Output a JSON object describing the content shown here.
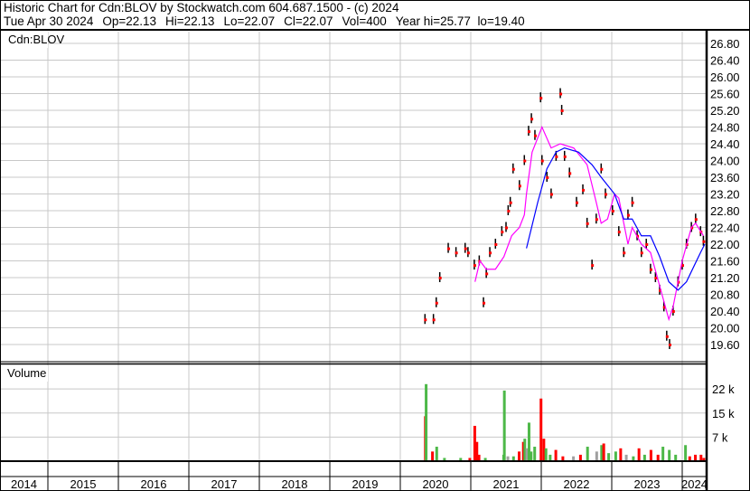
{
  "header": {
    "title": "Historic Chart for Cdn:BLOV by Stockwatch.com 604.687.1500 - (c) 2024",
    "date": "Tue Apr 30 2024",
    "open": "Op=22.13",
    "high": "Hi=22.13",
    "low": "Lo=22.07",
    "close": "Cl=22.07",
    "volume": "Vol=400",
    "year_range": "Year hi=25.77  lo=19.40"
  },
  "chart_data": [
    {
      "type": "line",
      "title": "Cdn:BLOV",
      "xlabel": "",
      "ylabel": "",
      "xlim": [
        2014,
        2024.35
      ],
      "ylim": [
        19.4,
        27.0
      ],
      "grid": true,
      "x_ticks": [
        "2014",
        "2015",
        "2016",
        "2017",
        "2018",
        "2019",
        "2020",
        "2021",
        "2022",
        "2023",
        "2024"
      ],
      "y_ticks": [
        "26.80",
        "26.40",
        "26.00",
        "25.60",
        "25.20",
        "24.80",
        "24.40",
        "24.00",
        "23.60",
        "23.20",
        "22.80",
        "22.40",
        "22.00",
        "21.60",
        "21.20",
        "20.80",
        "20.40",
        "20.00",
        "19.60"
      ],
      "colors": {
        "price": "#ff0000",
        "bar": "#000000",
        "ma_short": "#ff00ff",
        "ma_long": "#0000ff"
      },
      "series": [
        {
          "name": "price",
          "x": [
            2020.35,
            2020.47,
            2020.51,
            2020.56,
            2020.68,
            2020.79,
            2020.92,
            2020.96,
            2021.05,
            2021.12,
            2021.18,
            2021.22,
            2021.27,
            2021.35,
            2021.44,
            2021.5,
            2021.53,
            2021.56,
            2021.6,
            2021.69,
            2021.76,
            2021.82,
            2021.86,
            2021.91,
            2021.99,
            2022.01,
            2022.08,
            2022.14,
            2022.21,
            2022.27,
            2022.29,
            2022.33,
            2022.4,
            2022.5,
            2022.59,
            2022.65,
            2022.72,
            2022.78,
            2022.85,
            2022.91,
            2023.01,
            2023.1,
            2023.17,
            2023.23,
            2023.29,
            2023.36,
            2023.42,
            2023.49,
            2023.55,
            2023.62,
            2023.68,
            2023.74,
            2023.78,
            2023.82,
            2023.87,
            2023.94,
            2024.0,
            2024.06,
            2024.13,
            2024.19,
            2024.26,
            2024.3
          ],
          "y": [
            20.2,
            20.2,
            20.6,
            21.2,
            21.9,
            21.8,
            21.9,
            21.8,
            21.5,
            21.6,
            20.6,
            21.3,
            21.8,
            22.0,
            22.3,
            22.4,
            22.8,
            23.0,
            23.8,
            23.4,
            24.0,
            24.7,
            25.0,
            24.6,
            25.5,
            24.0,
            23.6,
            23.2,
            24.1,
            25.6,
            25.2,
            24.1,
            23.7,
            23.0,
            23.3,
            22.5,
            21.5,
            22.6,
            23.8,
            23.2,
            22.8,
            22.3,
            21.8,
            22.7,
            23.0,
            22.2,
            21.8,
            22.0,
            21.4,
            21.2,
            20.9,
            20.5,
            19.8,
            19.6,
            20.4,
            21.1,
            21.5,
            22.0,
            22.4,
            22.6,
            22.3,
            22.07
          ]
        },
        {
          "name": "ma_short",
          "x": [
            2021.06,
            2021.13,
            2021.22,
            2021.35,
            2021.47,
            2021.58,
            2021.69,
            2021.76,
            2021.79,
            2021.87,
            2022.01,
            2022.14,
            2022.27,
            2022.46,
            2022.65,
            2022.78,
            2022.85,
            2022.94,
            2023.04,
            2023.1,
            2023.23,
            2023.29,
            2023.42,
            2023.55,
            2023.68,
            2023.81,
            2023.87,
            2024.0,
            2024.13,
            2024.19,
            2024.3
          ],
          "y": [
            21.1,
            21.6,
            21.4,
            21.4,
            21.7,
            22.2,
            22.4,
            22.7,
            23.2,
            24.2,
            24.8,
            24.3,
            24.4,
            24.3,
            23.9,
            23.0,
            22.5,
            22.6,
            23.2,
            23.1,
            22.0,
            22.4,
            22.0,
            21.8,
            21.0,
            20.2,
            20.5,
            21.6,
            22.4,
            22.5,
            22.2
          ]
        },
        {
          "name": "ma_long",
          "x": [
            2021.79,
            2021.95,
            2022.08,
            2022.21,
            2022.33,
            2022.53,
            2022.72,
            2022.85,
            2023.04,
            2023.17,
            2023.29,
            2023.42,
            2023.55,
            2023.68,
            2023.81,
            2023.94,
            2024.06,
            2024.26,
            2024.32
          ],
          "y": [
            21.9,
            23.0,
            23.8,
            24.2,
            24.3,
            24.2,
            23.9,
            23.6,
            23.2,
            22.6,
            22.6,
            22.2,
            22.2,
            21.7,
            21.1,
            20.9,
            21.1,
            21.8,
            22.0
          ]
        }
      ]
    },
    {
      "type": "bar",
      "title": "Volume",
      "ylim": [
        0,
        28
      ],
      "y_ticks": [
        {
          "label": "22 k",
          "value": 22.5
        },
        {
          "label": "15 k",
          "value": 15
        },
        {
          "label": "7 k",
          "value": 7.5
        }
      ],
      "colors": {
        "up": "#4db848",
        "down": "#ff0000",
        "flat": "#a0a0a0"
      },
      "bars": [
        {
          "x": 2020.35,
          "v": 14,
          "c": "down"
        },
        {
          "x": 2020.36,
          "v": 24,
          "c": "up"
        },
        {
          "x": 2020.45,
          "v": 3,
          "c": "down"
        },
        {
          "x": 2020.51,
          "v": 4.5,
          "c": "up"
        },
        {
          "x": 2020.62,
          "v": 1,
          "c": "up"
        },
        {
          "x": 2020.85,
          "v": 1,
          "c": "up"
        },
        {
          "x": 2020.98,
          "v": 1,
          "c": "down"
        },
        {
          "x": 2021.05,
          "v": 11,
          "c": "down"
        },
        {
          "x": 2021.08,
          "v": 6,
          "c": "down"
        },
        {
          "x": 2021.11,
          "v": 2,
          "c": "down"
        },
        {
          "x": 2021.2,
          "v": 1,
          "c": "up"
        },
        {
          "x": 2021.46,
          "v": 2,
          "c": "up"
        },
        {
          "x": 2021.47,
          "v": 22,
          "c": "up"
        },
        {
          "x": 2021.52,
          "v": 1.5,
          "c": "flat"
        },
        {
          "x": 2021.6,
          "v": 1.5,
          "c": "up"
        },
        {
          "x": 2021.68,
          "v": 3,
          "c": "down"
        },
        {
          "x": 2021.74,
          "v": 6,
          "c": "down"
        },
        {
          "x": 2021.76,
          "v": 7,
          "c": "up"
        },
        {
          "x": 2021.79,
          "v": 4,
          "c": "flat"
        },
        {
          "x": 2021.82,
          "v": 12,
          "c": "up"
        },
        {
          "x": 2021.85,
          "v": 3,
          "c": "up"
        },
        {
          "x": 2021.9,
          "v": 4.5,
          "c": "up"
        },
        {
          "x": 2021.99,
          "v": 19.5,
          "c": "down"
        },
        {
          "x": 2022.03,
          "v": 7,
          "c": "down"
        },
        {
          "x": 2022.06,
          "v": 4,
          "c": "up"
        },
        {
          "x": 2022.12,
          "v": 2,
          "c": "up"
        },
        {
          "x": 2022.2,
          "v": 3.5,
          "c": "down"
        },
        {
          "x": 2022.3,
          "v": 1.5,
          "c": "down"
        },
        {
          "x": 2022.45,
          "v": 1.5,
          "c": "flat"
        },
        {
          "x": 2022.55,
          "v": 2,
          "c": "down"
        },
        {
          "x": 2022.65,
          "v": 4.5,
          "c": "up"
        },
        {
          "x": 2022.78,
          "v": 3,
          "c": "flat"
        },
        {
          "x": 2022.85,
          "v": 5,
          "c": "up"
        },
        {
          "x": 2022.88,
          "v": 5.5,
          "c": "down"
        },
        {
          "x": 2022.95,
          "v": 2.5,
          "c": "up"
        },
        {
          "x": 2023.05,
          "v": 3,
          "c": "up"
        },
        {
          "x": 2023.12,
          "v": 4,
          "c": "down"
        },
        {
          "x": 2023.2,
          "v": 2,
          "c": "flat"
        },
        {
          "x": 2023.3,
          "v": 1.5,
          "c": "up"
        },
        {
          "x": 2023.38,
          "v": 4,
          "c": "down"
        },
        {
          "x": 2023.46,
          "v": 2,
          "c": "up"
        },
        {
          "x": 2023.55,
          "v": 3.5,
          "c": "down"
        },
        {
          "x": 2023.65,
          "v": 2,
          "c": "down"
        },
        {
          "x": 2023.72,
          "v": 4.5,
          "c": "up"
        },
        {
          "x": 2023.81,
          "v": 3.5,
          "c": "up"
        },
        {
          "x": 2023.9,
          "v": 2,
          "c": "up"
        },
        {
          "x": 2024.04,
          "v": 5,
          "c": "up"
        },
        {
          "x": 2024.1,
          "v": 1.5,
          "c": "down"
        },
        {
          "x": 2024.18,
          "v": 2,
          "c": "down"
        },
        {
          "x": 2024.26,
          "v": 2,
          "c": "down"
        },
        {
          "x": 2024.3,
          "v": 1,
          "c": "down"
        }
      ]
    }
  ]
}
